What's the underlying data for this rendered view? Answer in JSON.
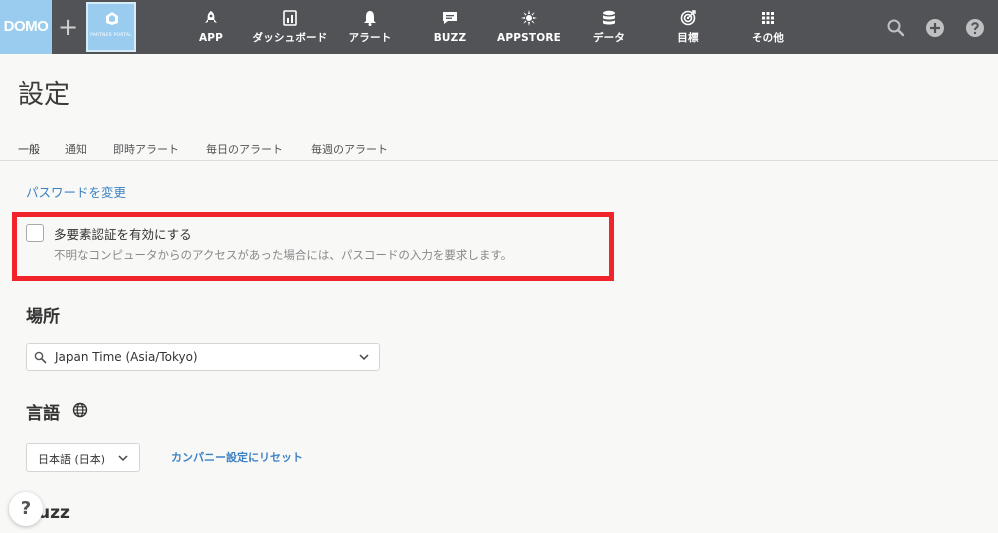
{
  "topnav": {
    "logo": "DOMO",
    "plus": "+",
    "partner_portal": "PARTNER PORTAL",
    "items": [
      {
        "label": "APP",
        "icon": "rocket-icon"
      },
      {
        "label": "ダッシュボード",
        "icon": "dashboard-icon"
      },
      {
        "label": "アラート",
        "icon": "bell-icon"
      },
      {
        "label": "BUZZ",
        "icon": "chat-icon"
      },
      {
        "label": "APPSTORE",
        "icon": "appstore-icon"
      },
      {
        "label": "データ",
        "icon": "database-icon"
      },
      {
        "label": "目標",
        "icon": "target-icon"
      },
      {
        "label": "その他",
        "icon": "grid-icon"
      }
    ],
    "right_icons": [
      "search-icon",
      "add-icon",
      "help-icon"
    ]
  },
  "page": {
    "title": "設定",
    "tabs": [
      "一般",
      "通知",
      "即時アラート",
      "毎日のアラート",
      "毎週のアラート"
    ],
    "active_tab": "一般"
  },
  "general": {
    "change_password": "パスワードを変更",
    "mfa_label": "多要素認証を有効にする",
    "mfa_desc": "不明なコンピュータからのアクセスがあった場合には、パスコードの入力を要求します。",
    "mfa_checked": false,
    "location_title": "場所",
    "timezone_value": "Japan Time (Asia/Tokyo)",
    "language_title": "言語",
    "language_value": "日本語 (日本)",
    "reset_link": "カンパニー設定にリセット",
    "buzz_title": "uzz",
    "help_button": "?"
  },
  "colors": {
    "nav_bg": "#525357",
    "logo_bg": "#99ccee",
    "link": "#3d82c3",
    "highlight": "#f2242b"
  }
}
